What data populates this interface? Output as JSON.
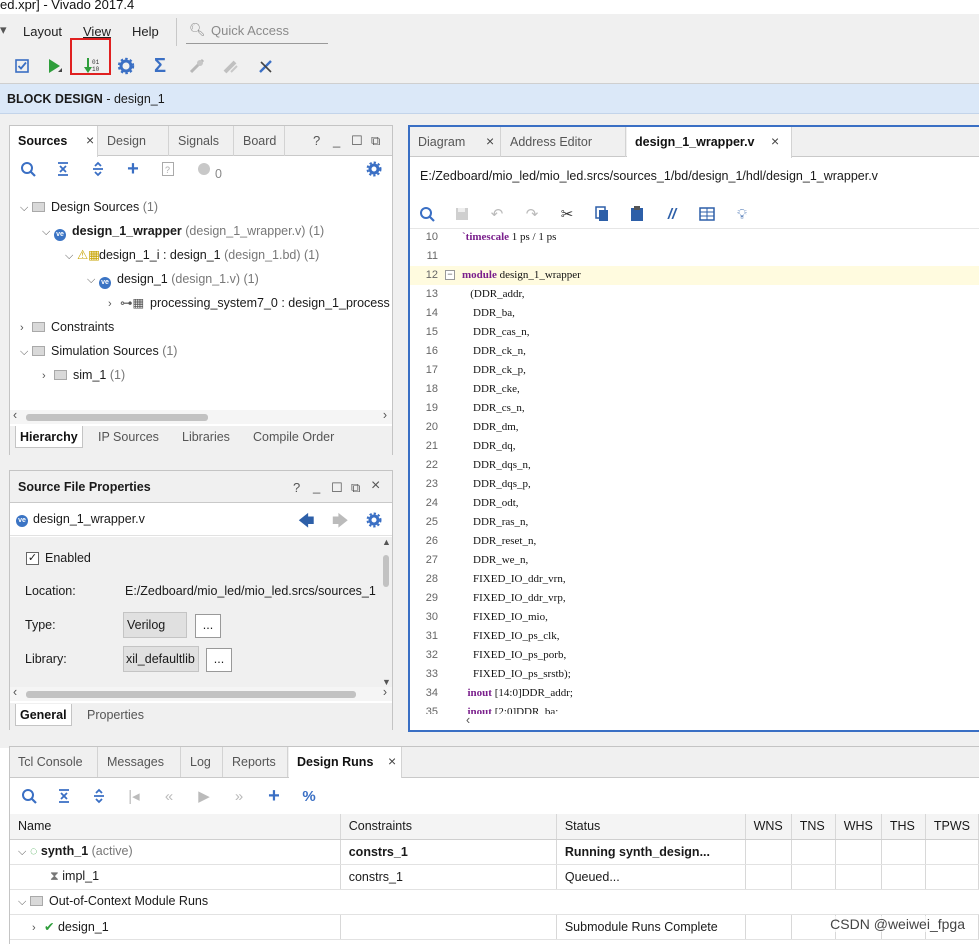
{
  "window": {
    "title": "ed.xpr] - Vivado 2017.4"
  },
  "menu": [
    {
      "label": "Layout"
    },
    {
      "label": "View"
    },
    {
      "label": "Help"
    }
  ],
  "quick_access": {
    "placeholder": "Quick Access"
  },
  "block_design": {
    "prefix": "BLOCK DESIGN",
    "sep": " - ",
    "name": "design_1"
  },
  "sources_panel": {
    "tabs": [
      {
        "label": "Sources"
      },
      {
        "label": "Design"
      },
      {
        "label": "Signals"
      },
      {
        "label": "Board"
      }
    ],
    "badge_count": "0",
    "tree": [
      {
        "label": "Design Sources",
        "meta": "(1)"
      },
      {
        "label": "design_1_wrapper",
        "meta": "(design_1_wrapper.v) (1)"
      },
      {
        "label": "design_1_i : design_1",
        "meta": "(design_1.bd) (1)"
      },
      {
        "label": "design_1",
        "meta": "(design_1.v) (1)"
      },
      {
        "label": "processing_system7_0 : design_1_process",
        "meta": ""
      },
      {
        "label": "Constraints",
        "meta": ""
      },
      {
        "label": "Simulation Sources",
        "meta": "(1)"
      },
      {
        "label": "sim_1",
        "meta": "(1)"
      }
    ],
    "bottom_tabs": [
      {
        "label": "Hierarchy"
      },
      {
        "label": "IP Sources"
      },
      {
        "label": "Libraries"
      },
      {
        "label": "Compile Order"
      }
    ]
  },
  "properties_panel": {
    "title": "Source File Properties",
    "file": "design_1_wrapper.v",
    "enabled_label": "Enabled",
    "location_label": "Location:",
    "location_value": "E:/Zedboard/mio_led/mio_led.srcs/sources_1",
    "type_label": "Type:",
    "type_value": "Verilog",
    "library_label": "Library:",
    "library_value": "xil_defaultlib",
    "browse": "...",
    "bottom_tabs": [
      {
        "label": "General"
      },
      {
        "label": "Properties"
      }
    ]
  },
  "editor": {
    "tabs": [
      {
        "label": "Diagram"
      },
      {
        "label": "Address Editor"
      },
      {
        "label": "design_1_wrapper.v"
      }
    ],
    "path": "E:/Zedboard/mio_led/mio_led.srcs/sources_1/bd/design_1/hdl/design_1_wrapper.v",
    "lines": [
      {
        "n": "10",
        "t": "`timescale 1 ps / 1 ps"
      },
      {
        "n": "11",
        "t": ""
      },
      {
        "n": "12",
        "t": "module design_1_wrapper"
      },
      {
        "n": "13",
        "t": "   (DDR_addr,"
      },
      {
        "n": "14",
        "t": "    DDR_ba,"
      },
      {
        "n": "15",
        "t": "    DDR_cas_n,"
      },
      {
        "n": "16",
        "t": "    DDR_ck_n,"
      },
      {
        "n": "17",
        "t": "    DDR_ck_p,"
      },
      {
        "n": "18",
        "t": "    DDR_cke,"
      },
      {
        "n": "19",
        "t": "    DDR_cs_n,"
      },
      {
        "n": "20",
        "t": "    DDR_dm,"
      },
      {
        "n": "21",
        "t": "    DDR_dq,"
      },
      {
        "n": "22",
        "t": "    DDR_dqs_n,"
      },
      {
        "n": "23",
        "t": "    DDR_dqs_p,"
      },
      {
        "n": "24",
        "t": "    DDR_odt,"
      },
      {
        "n": "25",
        "t": "    DDR_ras_n,"
      },
      {
        "n": "26",
        "t": "    DDR_reset_n,"
      },
      {
        "n": "27",
        "t": "    DDR_we_n,"
      },
      {
        "n": "28",
        "t": "    FIXED_IO_ddr_vrn,"
      },
      {
        "n": "29",
        "t": "    FIXED_IO_ddr_vrp,"
      },
      {
        "n": "30",
        "t": "    FIXED_IO_mio,"
      },
      {
        "n": "31",
        "t": "    FIXED_IO_ps_clk,"
      },
      {
        "n": "32",
        "t": "    FIXED_IO_ps_porb,"
      },
      {
        "n": "33",
        "t": "    FIXED_IO_ps_srstb);"
      },
      {
        "n": "34",
        "t": "  inout [14:0]DDR_addr;"
      },
      {
        "n": "35",
        "t": "  inout [2:0]DDR_ba;"
      }
    ]
  },
  "bottom_panel": {
    "tabs": [
      {
        "label": "Tcl Console"
      },
      {
        "label": "Messages"
      },
      {
        "label": "Log"
      },
      {
        "label": "Reports"
      },
      {
        "label": "Design Runs"
      }
    ],
    "columns": [
      "Name",
      "Constraints",
      "Status",
      "WNS",
      "TNS",
      "WHS",
      "THS",
      "TPWS"
    ],
    "rows": [
      {
        "name": "synth_1",
        "meta": "(active)",
        "constraints": "constrs_1",
        "status": "Running synth_design..."
      },
      {
        "name": "impl_1",
        "meta": "",
        "constraints": "constrs_1",
        "status": "Queued..."
      },
      {
        "name": "Out-of-Context Module Runs",
        "meta": "",
        "constraints": "",
        "status": ""
      },
      {
        "name": "design_1",
        "meta": "",
        "constraints": "",
        "status": "Submodule Runs Complete"
      }
    ]
  },
  "watermark": "CSDN @weiwei_fpga",
  "colors": {
    "accent_blue": "#3a6fc4",
    "header_bg": "#dbe8f8",
    "run_green": "#2e9e3b",
    "highlight_red": "#e02020"
  }
}
